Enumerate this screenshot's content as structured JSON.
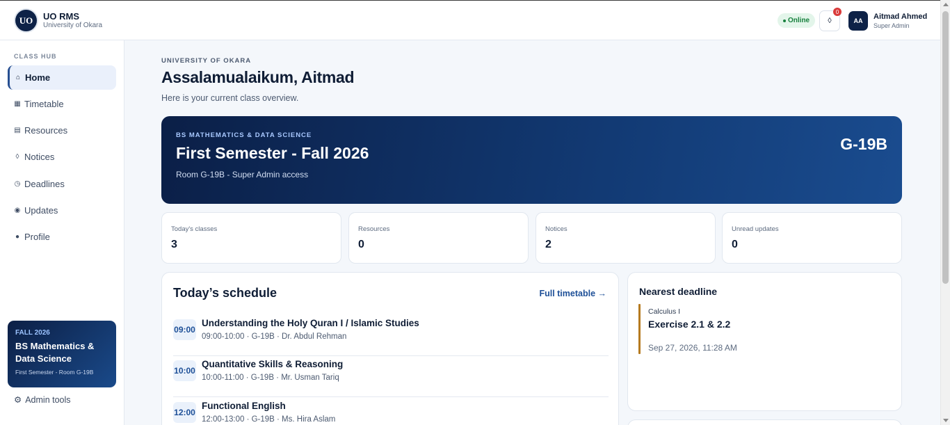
{
  "header": {
    "logo_text": "UO",
    "app_name": "UO RMS",
    "university": "University of Okara",
    "status": "Online",
    "notifications_count": "0",
    "notification_icon": "diamond-bell-icon",
    "avatar_initials": "AA",
    "user_name": "Aitmad Ahmed",
    "user_role": "Super Admin"
  },
  "sidebar": {
    "section_label": "CLASS HUB",
    "items": [
      {
        "label": "Home",
        "icon": "⌂",
        "icon_name": "home-icon",
        "active": true
      },
      {
        "label": "Timetable",
        "icon": "▦",
        "icon_name": "timetable-icon",
        "active": false
      },
      {
        "label": "Resources",
        "icon": "▤",
        "icon_name": "resources-icon",
        "active": false
      },
      {
        "label": "Notices",
        "icon": "◊",
        "icon_name": "notices-icon",
        "active": false
      },
      {
        "label": "Deadlines",
        "icon": "◷",
        "icon_name": "clock-icon",
        "active": false
      },
      {
        "label": "Updates",
        "icon": "◉",
        "icon_name": "updates-icon",
        "active": false
      },
      {
        "label": "Profile",
        "icon": "●",
        "icon_name": "profile-icon",
        "active": false
      }
    ],
    "card": {
      "term": "FALL 2026",
      "program": "BS Mathematics & Data Science",
      "detail": "First Semester - Room G-19B"
    },
    "admin_tools": "Admin tools",
    "admin_icon": "⚙"
  },
  "main": {
    "eyebrow": "UNIVERSITY OF OKARA",
    "greeting": "Assalamualaikum, Aitmad",
    "subtext": "Here is your current class overview.",
    "hero": {
      "program": "BS MATHEMATICS & DATA SCIENCE",
      "semester": "First Semester - Fall 2026",
      "room": "Room G-19B - Super Admin access",
      "section_code": "G-19B"
    },
    "stats": [
      {
        "label": "Today's classes",
        "value": "3"
      },
      {
        "label": "Resources",
        "value": "0"
      },
      {
        "label": "Notices",
        "value": "2"
      },
      {
        "label": "Unread updates",
        "value": "0"
      }
    ],
    "schedule": {
      "title": "Today’s schedule",
      "link": "Full timetable →",
      "classes": [
        {
          "time": "09:00",
          "course": "Understanding the Holy Quran I / Islamic Studies",
          "meta": "09:00-10:00 · G-19B · Dr. Abdul Rehman"
        },
        {
          "time": "10:00",
          "course": "Quantitative Skills & Reasoning",
          "meta": "10:00-11:00 · G-19B · Mr. Usman Tariq"
        },
        {
          "time": "12:00",
          "course": "Functional English",
          "meta": "12:00-13:00 · G-19B · Ms. Hira Aslam"
        }
      ]
    },
    "deadline": {
      "title": "Nearest deadline",
      "course": "Calculus I",
      "task": "Exercise 2.1 & 2.2",
      "date": "Sep 27, 2026, 11:28 AM"
    }
  },
  "colors": {
    "brand_navy": "#0e2247",
    "accent_blue": "#1d4f97",
    "online_green": "#17803d",
    "deadline_accent": "#b57a1f",
    "badge_red": "#d93a3a"
  }
}
